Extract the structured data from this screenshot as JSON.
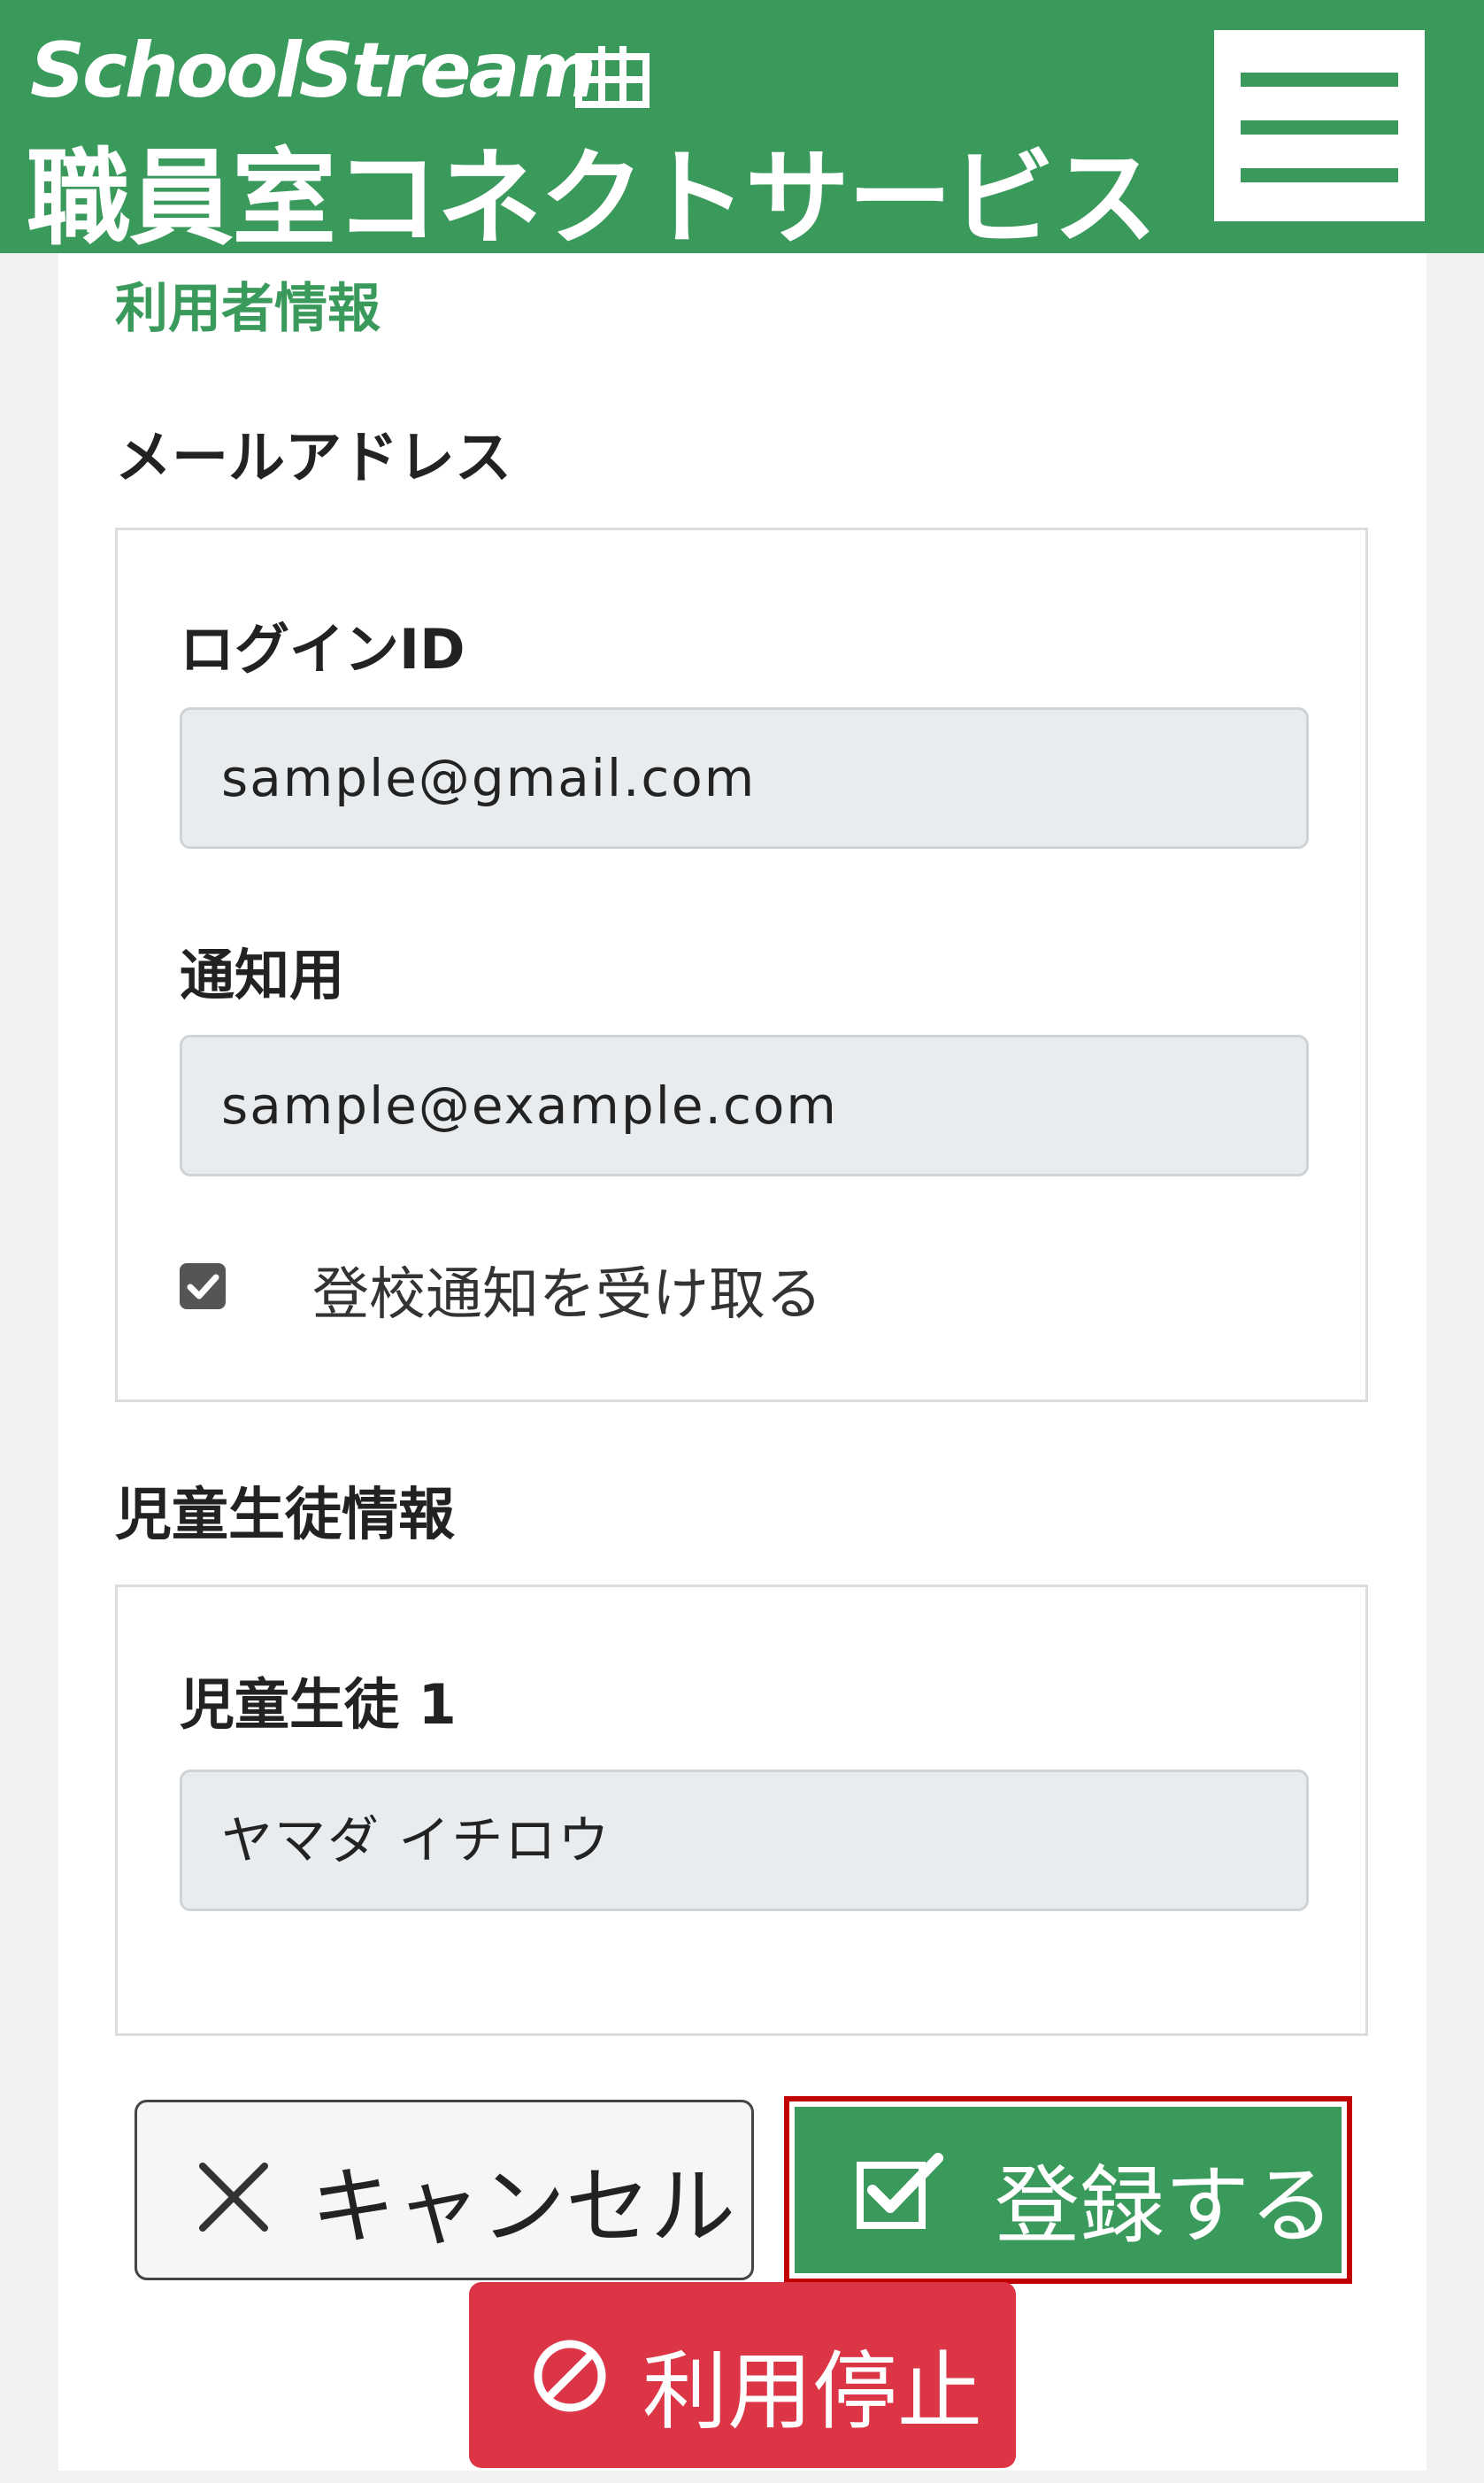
{
  "header": {
    "brand_en": "SchoolStream",
    "brand_jp": "職員室コネクトサービス",
    "menu_icon": "hamburger-menu-icon",
    "color": "#3a9a5c"
  },
  "user_info": {
    "section_title": "利用者情報",
    "email_heading": "メールアドレス",
    "login_id_label": "ログインID",
    "login_id_value": "sample@gmail.com",
    "notify_label": "通知用",
    "notify_value": "sample@example.com",
    "attendance_notify_checked": true,
    "attendance_notify_label": "登校通知を受け取る"
  },
  "student_info": {
    "heading": "児童生徒情報",
    "students": [
      {
        "label": "児童生徒 1",
        "name": "ヤマダ イチロウ"
      }
    ]
  },
  "actions": {
    "cancel_label": "キャンセル",
    "cancel_icon": "close-icon",
    "register_label": "登録する",
    "register_icon": "check-square-icon",
    "stop_label": "利用停止",
    "stop_icon": "prohibited-icon",
    "register_color": "#3a9a5c",
    "stop_color": "#dc3545",
    "highlight_color": "#c00000"
  }
}
